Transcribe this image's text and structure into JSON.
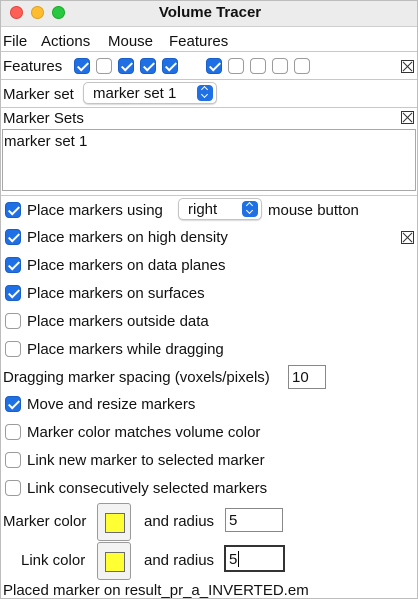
{
  "window": {
    "title": "Volume Tracer"
  },
  "menubar": {
    "items": [
      "File",
      "Actions",
      "Mouse",
      "Features"
    ]
  },
  "features": {
    "label": "Features",
    "checkboxes": [
      true,
      false,
      true,
      true,
      true,
      true,
      false,
      false,
      false,
      false
    ]
  },
  "marker_set": {
    "label": "Marker set",
    "selected": "marker set 1"
  },
  "marker_sets_panel": {
    "title": "Marker Sets",
    "items": [
      "marker set 1"
    ]
  },
  "options": {
    "place_using": {
      "label": "Place markers using",
      "button": "right",
      "suffix": "mouse button",
      "checked": true
    },
    "high_density": {
      "label": "Place markers on high density",
      "checked": true
    },
    "data_planes": {
      "label": "Place markers on data planes",
      "checked": true
    },
    "surfaces": {
      "label": "Place markers on surfaces",
      "checked": true
    },
    "outside_data": {
      "label": "Place markers outside data",
      "checked": false
    },
    "while_dragging": {
      "label": "Place markers while dragging",
      "checked": false
    },
    "spacing": {
      "label": "Dragging marker spacing (voxels/pixels)",
      "value": "10"
    },
    "move_resize": {
      "label": "Move and resize markers",
      "checked": true
    },
    "color_match": {
      "label": "Marker color matches volume color",
      "checked": false
    },
    "link_new": {
      "label": "Link new marker to selected marker",
      "checked": false
    },
    "link_consecutive": {
      "label": "Link consecutively selected markers",
      "checked": false
    }
  },
  "marker_color": {
    "label": "Marker color",
    "radius_label": "and radius",
    "radius": "5",
    "color": "#ffff33"
  },
  "link_color": {
    "label": "Link color",
    "radius_label": "and radius",
    "radius": "5",
    "color": "#ffff33"
  },
  "status": "Placed marker on result_pr_a_INVERTED.em",
  "colors": {
    "accent": "#1f6fe5",
    "swatch": "#ffff33"
  }
}
